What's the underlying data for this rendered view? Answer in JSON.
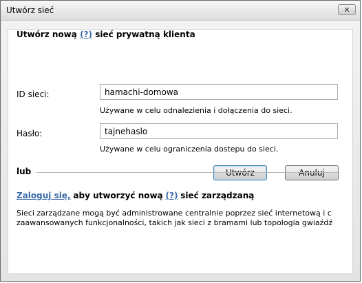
{
  "window": {
    "title": "Utwórz sieć",
    "close_glyph": "✕"
  },
  "form": {
    "heading_prefix": "Utwórz nową",
    "heading_help": "(?)",
    "heading_suffix": "sieć prywatną klienta",
    "id_label": "ID sieci:",
    "id_value": "hamachi-domowa",
    "id_hint": "Używane w celu odnalezienia i dołączenia do sieci.",
    "password_label": "Hasło:",
    "password_value": "tajnehaslo",
    "password_hint": "Używane w celu ograniczenia dostepu do sieci.",
    "create_button": "Utwórz",
    "cancel_button": "Anuluj"
  },
  "or_section": {
    "label": "lub",
    "login_link": "Zaloguj się,",
    "text_prefix": "aby utworzyć nową",
    "help": "(?)",
    "text_suffix": "sieć zarządzaną",
    "desc_line1": "Sieci zarządzane mogą być administrowane centralnie poprzez sieć internetową i c",
    "desc_line2": "zaawansowanych funkcjonalności, takich jak sieci z bramami lub topologia gwiaźdź"
  }
}
